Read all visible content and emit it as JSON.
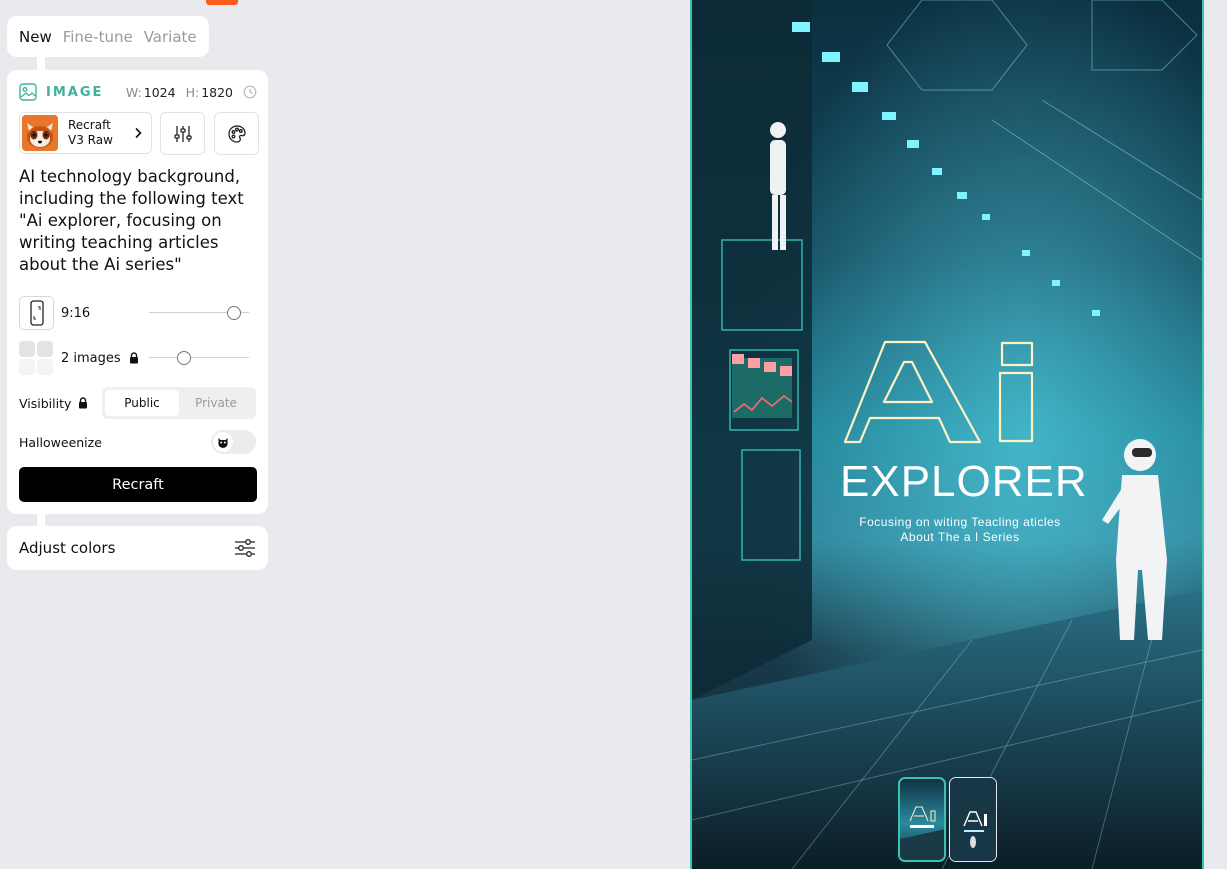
{
  "tabs": [
    {
      "label": "New",
      "active": true
    },
    {
      "label": "Fine-tune",
      "active": false
    },
    {
      "label": "Variate",
      "active": false
    }
  ],
  "image_panel": {
    "section_label": "IMAGE",
    "width_label": "W:",
    "width_value": "1024",
    "height_label": "H:",
    "height_value": "1820",
    "model": {
      "line1": "Recraft",
      "line2": "V3 Raw"
    },
    "prompt": "AI technology background, including the following text \"Ai explorer, focusing on writing teaching articles about the Ai series\"",
    "aspect_ratio": {
      "label": "9:16"
    },
    "count": {
      "label": "2 images",
      "locked": true
    },
    "visibility": {
      "label": "Visibility",
      "options": [
        "Public",
        "Private"
      ],
      "selected": "Public"
    },
    "halloweenize": {
      "label": "Halloweenize",
      "enabled": false
    },
    "generate_button": "Recraft"
  },
  "adjust_colors": {
    "label": "Adjust colors"
  },
  "canvas": {
    "poster_title": "EXPLORER",
    "poster_subtitle_line1": "Focusing on witing Teacling aticles",
    "poster_subtitle_line2": "About The a I Series",
    "thumbnails": 2,
    "selected_thumbnail": 1
  },
  "colors": {
    "accent": "#3fb39a",
    "orange": "#ff5b1f",
    "canvas_border": "#3cc3b0"
  }
}
